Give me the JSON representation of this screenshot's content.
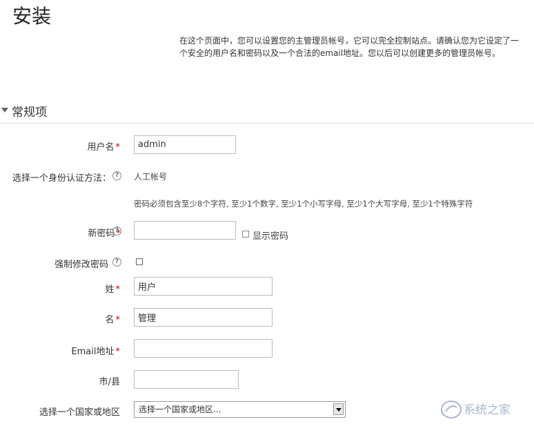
{
  "page": {
    "title": "安装",
    "intro": "在这个页面中，您可以设置您的主管理员帐号，它可以完全控制站点。请确认您为它设定了一个安全的用户名和密码以及一个合法的email地址。您以后可以创建更多的管理员帐号。"
  },
  "section": {
    "label": "常规项"
  },
  "form": {
    "username": {
      "label": "用户名",
      "value": "admin"
    },
    "auth": {
      "label": "选择一个身份认证方法：",
      "value": "人工帐号"
    },
    "password_rule": "密码必须包含至少8个字符, 至少1个数字, 至少1个小写字母, 至少1个大写字母, 至少1个特殊字符",
    "new_password": {
      "label": "新密码",
      "value": "",
      "show_label": "显示密码",
      "show_checked": false
    },
    "force_change": {
      "label": "强制修改密码",
      "checked": false
    },
    "lastname": {
      "label": "姓",
      "value": "用户"
    },
    "firstname": {
      "label": "名",
      "value": "管理"
    },
    "email": {
      "label": "Email地址",
      "value": ""
    },
    "city": {
      "label": "市/县",
      "value": ""
    },
    "country": {
      "label": "选择一个国家或地区",
      "selected": "选择一个国家或地区..."
    }
  },
  "required_mark": "*",
  "help_glyph": "?",
  "watermark": "系统之家"
}
